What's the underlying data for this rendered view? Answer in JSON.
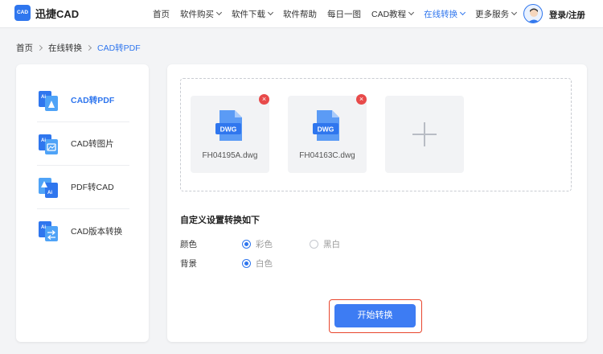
{
  "header": {
    "logo_badge": "CAD",
    "logo_text": "迅捷CAD",
    "nav": [
      {
        "label": "首页",
        "dropdown": false,
        "active": false
      },
      {
        "label": "软件购买",
        "dropdown": true,
        "active": false
      },
      {
        "label": "软件下载",
        "dropdown": true,
        "active": false
      },
      {
        "label": "软件帮助",
        "dropdown": false,
        "active": false
      },
      {
        "label": "每日一图",
        "dropdown": false,
        "active": false
      },
      {
        "label": "CAD教程",
        "dropdown": true,
        "active": false
      },
      {
        "label": "在线转换",
        "dropdown": true,
        "active": true
      },
      {
        "label": "更多服务",
        "dropdown": true,
        "active": false
      }
    ],
    "login_label": "登录/注册"
  },
  "breadcrumb": [
    "首页",
    "在线转换",
    "CAD转PDF"
  ],
  "sidebar": {
    "items": [
      {
        "label": "CAD转PDF",
        "icon": "cad-to-pdf-icon",
        "active": true
      },
      {
        "label": "CAD转图片",
        "icon": "cad-to-image-icon",
        "active": false
      },
      {
        "label": "PDF转CAD",
        "icon": "pdf-to-cad-icon",
        "active": false
      },
      {
        "label": "CAD版本转换",
        "icon": "cad-version-convert-icon",
        "active": false
      }
    ]
  },
  "upload": {
    "files": [
      {
        "badge": "DWG",
        "name": "FH04195A.dwg"
      },
      {
        "badge": "DWG",
        "name": "FH04163C.dwg"
      }
    ],
    "delete_symbol": "×"
  },
  "settings": {
    "title": "自定义设置转换如下",
    "color_label": "颜色",
    "color_options": [
      {
        "label": "彩色",
        "checked": true
      },
      {
        "label": "黑白",
        "checked": false
      }
    ],
    "background_label": "背景",
    "background_options": [
      {
        "label": "白色",
        "checked": true
      }
    ]
  },
  "actions": {
    "start_label": "开始转换"
  },
  "colors": {
    "accent": "#2f76ee",
    "danger": "#e84a4a",
    "highlight_border": "#e8452c"
  }
}
